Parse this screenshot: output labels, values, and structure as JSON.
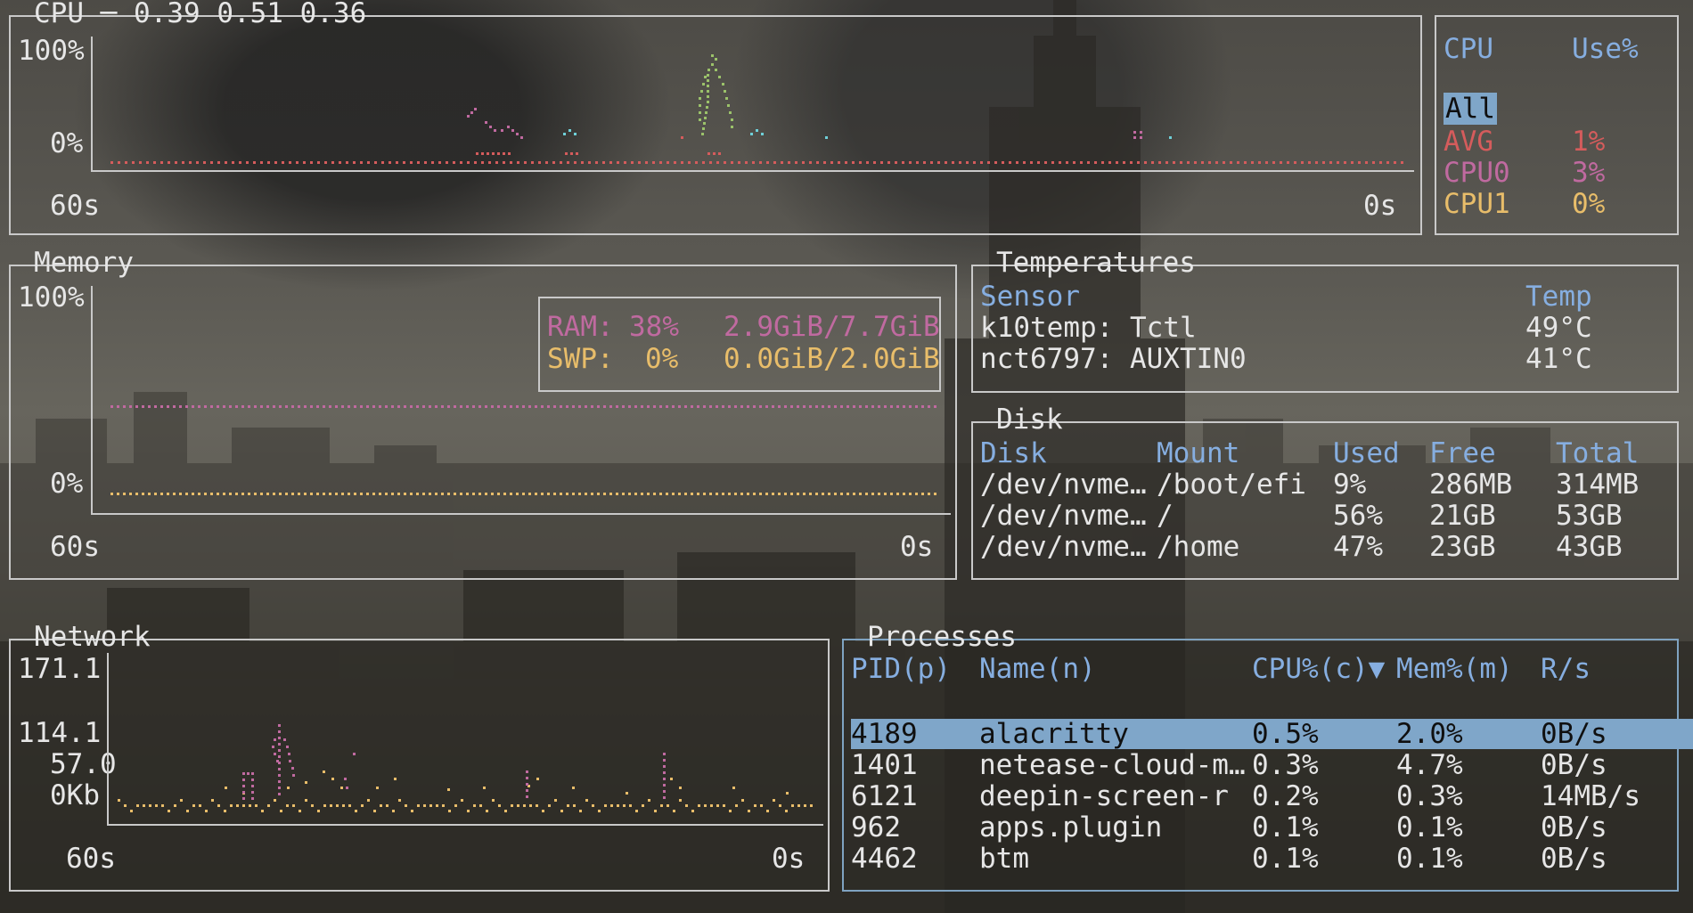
{
  "cpu": {
    "title": "CPU",
    "load": "0.39 0.51 0.36",
    "y_top": "100%",
    "y_bottom": "0%",
    "x_left": "60s",
    "x_right": "0s",
    "legend_header": {
      "cpu": "CPU",
      "use": "Use%"
    },
    "legend": [
      {
        "label": "All",
        "value": ""
      },
      {
        "label": "AVG",
        "value": "1%"
      },
      {
        "label": "CPU0",
        "value": "3%"
      },
      {
        "label": "CPU1",
        "value": "0%"
      }
    ]
  },
  "memory": {
    "title": "Memory",
    "y_top": "100%",
    "y_bottom": "0%",
    "x_left": "60s",
    "x_right": "0s",
    "ram": {
      "label": "RAM:",
      "percent": "38%",
      "usage": "2.9GiB/7.7GiB"
    },
    "swp": {
      "label": "SWP:",
      "percent": "0%",
      "usage": "0.0GiB/2.0GiB"
    }
  },
  "temperatures": {
    "title": "Temperatures",
    "headers": {
      "sensor": "Sensor",
      "temp": "Temp"
    },
    "rows": [
      {
        "sensor": "k10temp: Tctl",
        "temp": "49°C"
      },
      {
        "sensor": "nct6797: AUXTIN0",
        "temp": "41°C"
      }
    ]
  },
  "disk": {
    "title": "Disk",
    "headers": {
      "disk": "Disk",
      "mount": "Mount",
      "used": "Used",
      "free": "Free",
      "total": "Total"
    },
    "rows": [
      {
        "disk": "/dev/nvme…",
        "mount": "/boot/efi",
        "used": "9%",
        "free": "286MB",
        "total": "314MB"
      },
      {
        "disk": "/dev/nvme…",
        "mount": "/",
        "used": "56%",
        "free": "21GB",
        "total": "53GB"
      },
      {
        "disk": "/dev/nvme…",
        "mount": "/home",
        "used": "47%",
        "free": "23GB",
        "total": "43GB"
      }
    ]
  },
  "network": {
    "title": "Network",
    "y_labels": [
      "171.1",
      "114.1",
      "57.0",
      "0Kb"
    ],
    "x_left": "60s",
    "x_right": "0s"
  },
  "processes": {
    "title": "Processes",
    "headers": {
      "pid": "PID(p)",
      "name": "Name(n)",
      "cpu": "CPU%(c)▼",
      "mem": "Mem%(m)",
      "rs": "R/s"
    },
    "rows": [
      {
        "pid": "4189",
        "name": "alacritty",
        "cpu": "0.5%",
        "mem": "2.0%",
        "rs": "0B/s"
      },
      {
        "pid": "1401",
        "name": "netease-cloud-m…",
        "cpu": "0.3%",
        "mem": "4.7%",
        "rs": "0B/s"
      },
      {
        "pid": "6121",
        "name": "deepin-screen-r",
        "cpu": "0.2%",
        "mem": "0.3%",
        "rs": "14MB/s"
      },
      {
        "pid": "962",
        "name": "apps.plugin",
        "cpu": "0.1%",
        "mem": "0.1%",
        "rs": "0B/s"
      },
      {
        "pid": "4462",
        "name": "btm",
        "cpu": "0.1%",
        "mem": "0.1%",
        "rs": "0B/s"
      }
    ]
  },
  "colors": {
    "border": "#c9c9c9",
    "header_blue": "#86aee0",
    "selection": "#7fa6c9",
    "avg_red": "#d55c5c",
    "cpu0_pink": "#c06aa0",
    "cpu1_yellow": "#e8bd6a",
    "cyan": "#6fd0d8",
    "green": "#9bc26a"
  }
}
